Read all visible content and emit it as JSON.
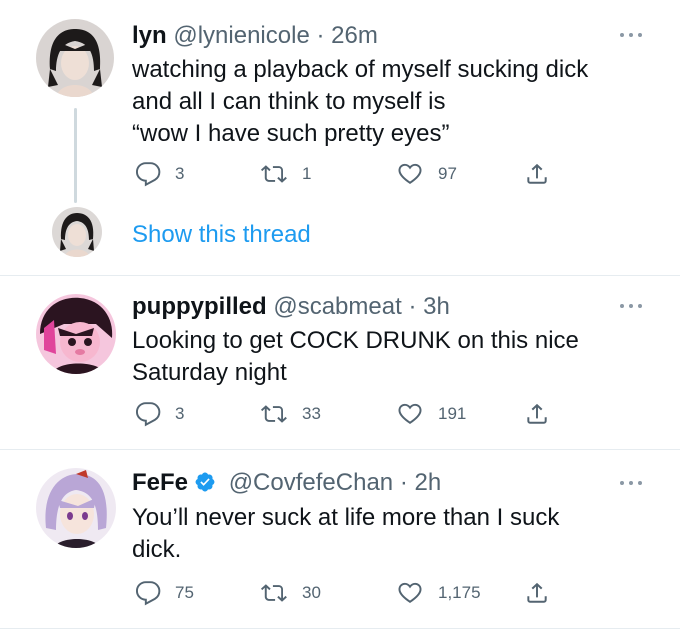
{
  "tweets": [
    {
      "name": "lyn",
      "handle": "@lynienicole",
      "time": "26m",
      "lines": [
        "watching a playback of myself sucking dick",
        "and all I can think to myself is",
        " “wow I have such pretty eyes”"
      ],
      "replies": "3",
      "retweets": "1",
      "likes": "97",
      "avatar_icon": "profile-photo-dark-hair"
    },
    {
      "name": "puppypilled",
      "handle": "@scabmeat",
      "time": "3h",
      "lines": [
        "Looking to get COCK DRUNK on this nice",
        "Saturday night"
      ],
      "replies": "3",
      "retweets": "33",
      "likes": "191",
      "avatar_icon": "illustrated-avatar-pink"
    },
    {
      "name": "FeFe",
      "handle": "@CovfefeChan",
      "time": "2h",
      "verified": true,
      "lines": [
        "You’ll never suck at life more than I suck",
        "dick."
      ],
      "replies": "75",
      "retweets": "30",
      "likes": "1,175",
      "avatar_icon": "anime-avatar-purple-hair"
    }
  ],
  "thread": {
    "show_label": "Show this thread"
  },
  "separator": "·",
  "colors": {
    "accent": "#1d9bf0",
    "verified": "#1d9bf0",
    "muted": "#536471",
    "divider": "#e6ecf0"
  },
  "icons": [
    "reply-icon",
    "retweet-icon",
    "like-icon",
    "share-icon",
    "more-icon",
    "verified-badge-icon"
  ]
}
